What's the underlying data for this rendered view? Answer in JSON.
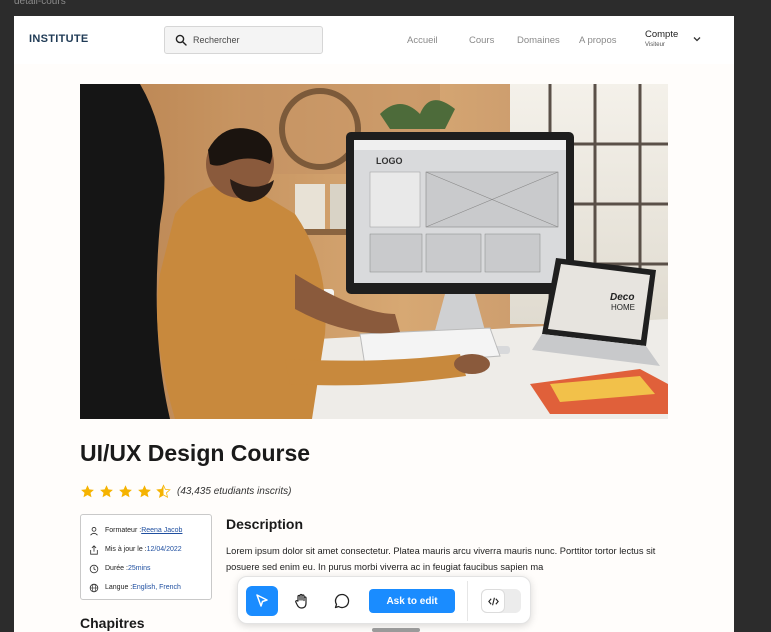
{
  "canvas": {
    "frame_label": "detail-cours"
  },
  "navbar": {
    "logo": "INSTITUTE",
    "search_placeholder": "Rechercher",
    "links": [
      "Accueil",
      "Cours",
      "Domaines",
      "A propos"
    ],
    "account_name": "Compte",
    "account_role": "Visiteur"
  },
  "course": {
    "title": "UI/UX Design Course",
    "rating": 4.5,
    "enrolled": "(43,435 etudiants inscrits)",
    "info": {
      "trainer_label": "Formateur : ",
      "trainer": "Reena Jacob",
      "updated_label": "Mis à jour le : ",
      "updated": "12/04/2022",
      "duration_label": "Durée : ",
      "duration": "25mins",
      "language_label": "Langue : ",
      "language": "English, French"
    },
    "description_title": "Description",
    "description_text": "Lorem ipsum dolor sit amet consectetur. Platea mauris arcu viverra mauris nunc. Porttitor tortor lectus sit posuere sed enim eu. In purus morbi viverra ac in feugiat faucibus sapien ma",
    "chapters_title": "Chapitres",
    "hero_screen_logo": "LOGO",
    "hero_laptop_text_1": "Deco",
    "hero_laptop_text_2": "HOME"
  },
  "toolbar": {
    "ask_label": "Ask to edit",
    "tools": [
      "cursor-icon",
      "hand-icon",
      "comment-icon"
    ],
    "active_tool": "cursor-icon"
  },
  "colors": {
    "accent": "#1a8cff",
    "logo": "#1f3a55",
    "star": "#f5b301",
    "link": "#1f4fa0"
  }
}
